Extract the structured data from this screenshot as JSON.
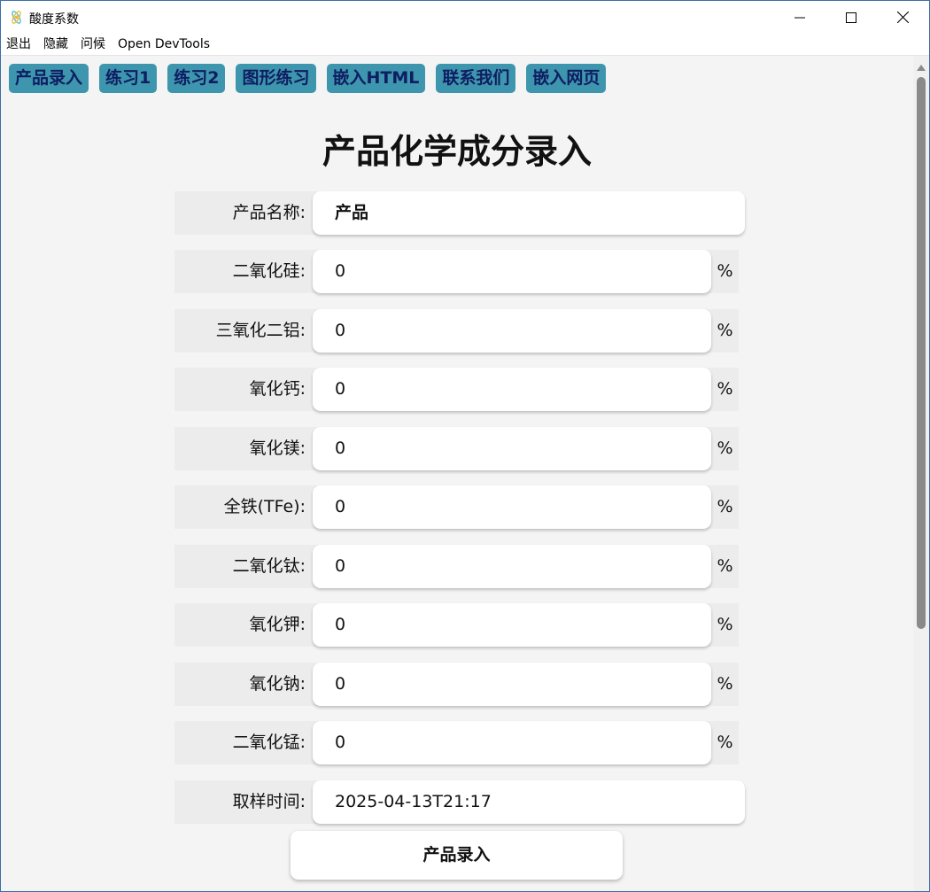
{
  "window": {
    "title": "酸度系数",
    "icon": "electron-app-icon",
    "controls": [
      "minimize-icon",
      "maximize-icon",
      "close-icon"
    ]
  },
  "menu": {
    "items": [
      "退出",
      "隐藏",
      "问候",
      "Open DevTools"
    ]
  },
  "tabs": [
    "产品录入",
    "练习1",
    "练习2",
    "图形练习",
    "嵌入HTML",
    "联系我们",
    "嵌入网页"
  ],
  "colors": {
    "tab_bg": "#3d96ad",
    "tab_text": "#0f1d62",
    "page_bg": "#f4f4f4"
  },
  "form": {
    "title": "产品化学成分录入",
    "product_name": {
      "label": "产品名称:",
      "value": "产品"
    },
    "components": [
      {
        "label": "二氧化硅:",
        "value": "0",
        "unit": "%"
      },
      {
        "label": "三氧化二铝:",
        "value": "0",
        "unit": "%"
      },
      {
        "label": "氧化钙:",
        "value": "0",
        "unit": "%"
      },
      {
        "label": "氧化镁:",
        "value": "0",
        "unit": "%"
      },
      {
        "label": "全铁(TFe):",
        "value": "0",
        "unit": "%"
      },
      {
        "label": "二氧化钛:",
        "value": "0",
        "unit": "%"
      },
      {
        "label": "氧化钾:",
        "value": "0",
        "unit": "%"
      },
      {
        "label": "氧化钠:",
        "value": "0",
        "unit": "%"
      },
      {
        "label": "二氧化锰:",
        "value": "0",
        "unit": "%"
      }
    ],
    "sample_time": {
      "label": "取样时间:",
      "value": "2025-04-13T21:17"
    },
    "submit_label": "产品录入"
  }
}
